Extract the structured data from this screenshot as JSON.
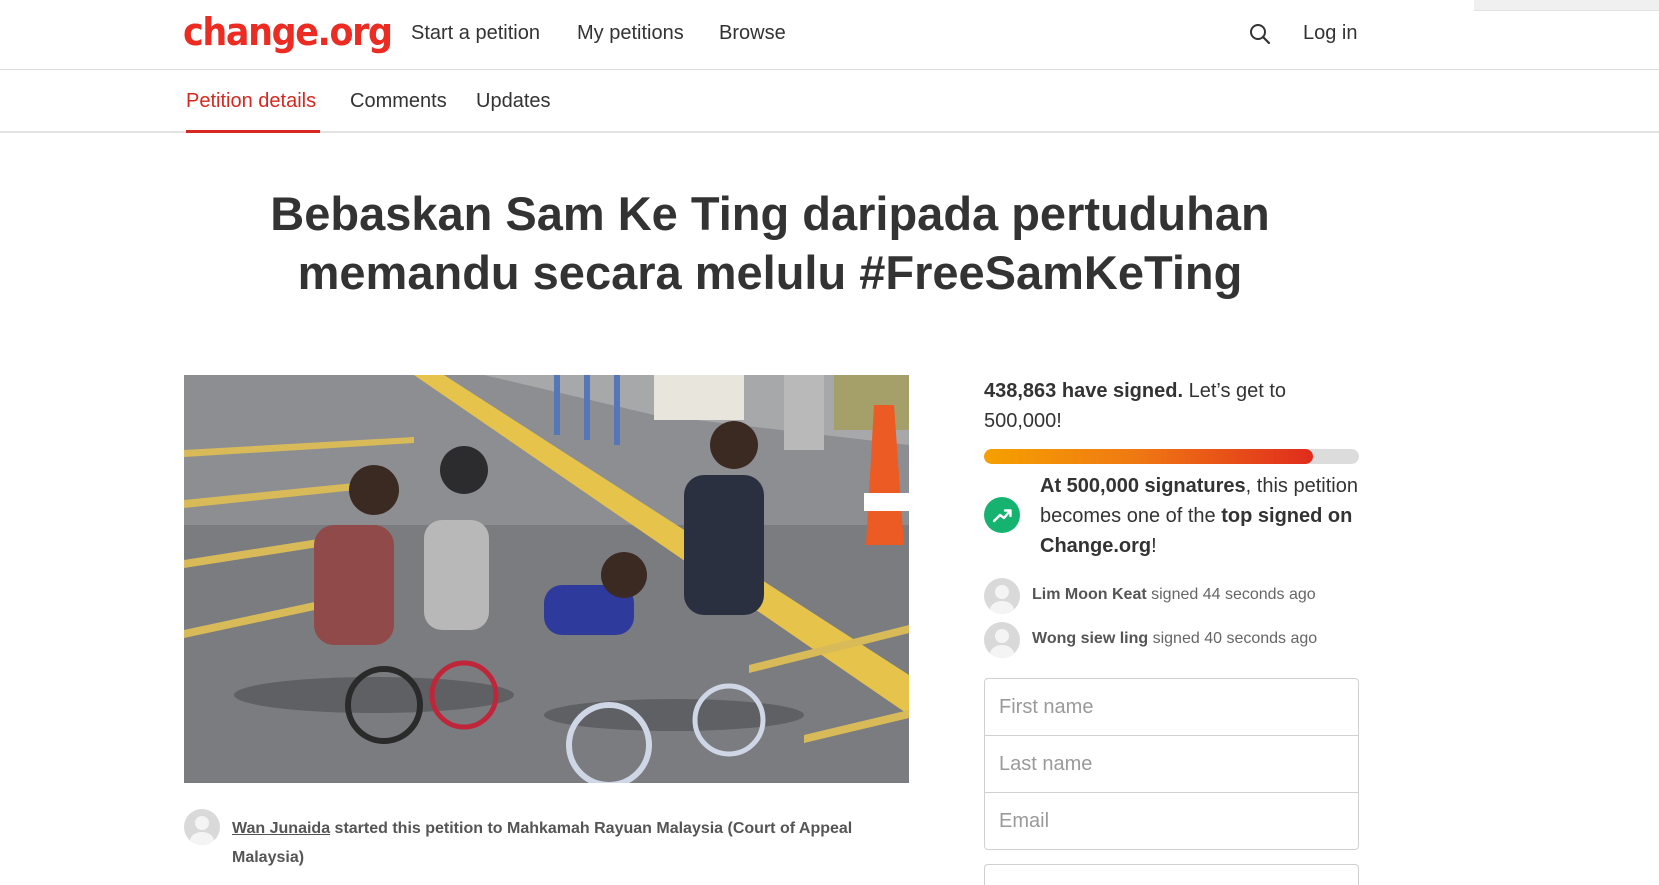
{
  "header": {
    "logo": "change.org",
    "nav": {
      "start": "Start a petition",
      "mine": "My petitions",
      "browse": "Browse"
    },
    "search_icon": "search-icon",
    "login": "Log in"
  },
  "tabs": [
    {
      "label": "Petition details",
      "active": true
    },
    {
      "label": "Comments",
      "active": false
    },
    {
      "label": "Updates",
      "active": false
    }
  ],
  "petition": {
    "title": "Bebaskan Sam Ke Ting daripada pertuduhan memandu secara melulu #FreeSamKeTing",
    "starter_name": "Wan Junaida",
    "starter_suffix": " started this petition to Mahkamah Rayuan Malaysia (Court of Appeal Malaysia)"
  },
  "signatures": {
    "count_text": "438,863 have signed.",
    "goal_text": " Let’s get to 500,000!",
    "progress": 0.8777,
    "progress_colors": [
      "#f5a000",
      "#e02c1d"
    ]
  },
  "milestone": {
    "icon": "trending-up-icon",
    "icon_color": "#16b370",
    "bold_1": "At 500,000 signatures",
    "text_1": ", this petition becomes one of the ",
    "bold_2": "top signed on Change.org",
    "text_2": "!"
  },
  "recent_signers": [
    {
      "name": "Lim Moon Keat",
      "action": " signed 44 seconds ago"
    },
    {
      "name": "Wong siew ling",
      "action": " signed 40 seconds ago"
    }
  ],
  "form": {
    "first_name_placeholder": "First name",
    "last_name_placeholder": "Last name",
    "email_placeholder": "Email"
  },
  "colors": {
    "brand_red": "#ec2c22",
    "active_tab": "#d6281f"
  }
}
